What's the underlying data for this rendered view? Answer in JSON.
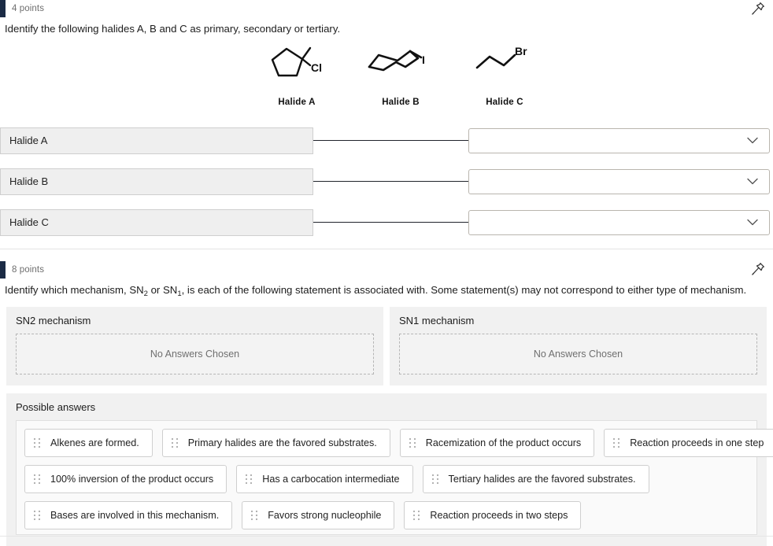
{
  "questions": [
    {
      "points": "4 points",
      "pin_icon": "pushpin-icon",
      "prompt_pre": "Identify the following halides A, B and C as primary, secondary or tertiary.",
      "structures": [
        {
          "label": "Halide A",
          "icon": "chloro-methyl-cyclopentane-structure",
          "atom": "Cl"
        },
        {
          "label": "Halide B",
          "icon": "iodocyclohexane-structure",
          "atom": "I"
        },
        {
          "label": "Halide C",
          "icon": "propyl-bromide-structure",
          "atom": "Br"
        }
      ],
      "match_rows": [
        {
          "left": "Halide A",
          "right_value": "",
          "chevron": "chevron-down-icon"
        },
        {
          "left": "Halide B",
          "right_value": "",
          "chevron": "chevron-down-icon"
        },
        {
          "left": "Halide C",
          "right_value": "",
          "chevron": "chevron-down-icon"
        }
      ]
    },
    {
      "points": "8 points",
      "pin_icon": "pushpin-icon",
      "prompt_p1": "Identify which mechanism, SN",
      "prompt_sub1": "2",
      "prompt_p2": " or SN",
      "prompt_sub2": "1",
      "prompt_p3": ", is each of the following statement is associated with. Some statement(s) may not correspond to either type of mechanism.",
      "drop_zones": [
        {
          "title": "SN2 mechanism",
          "empty_text": "No Answers Chosen"
        },
        {
          "title": "SN1 mechanism",
          "empty_text": "No Answers Chosen"
        }
      ],
      "answers_title": "Possible answers",
      "answer_chips": [
        [
          "Alkenes are formed.",
          "Primary halides are the favored substrates.",
          "Racemization of the product occurs",
          "Reaction proceeds in one step"
        ],
        [
          "100% inversion of the product occurs",
          "Has a carbocation intermediate",
          "Tertiary halides are the favored substrates."
        ],
        [
          "Bases are involved in this mechanism.",
          "Favors strong nucleophile",
          "Reaction proceeds in two steps"
        ]
      ]
    }
  ],
  "colors": {
    "points_bar": "#1b2b45",
    "panel_bg": "#f1f1f1",
    "row_bg": "#efefef",
    "connector": "#20232b"
  }
}
